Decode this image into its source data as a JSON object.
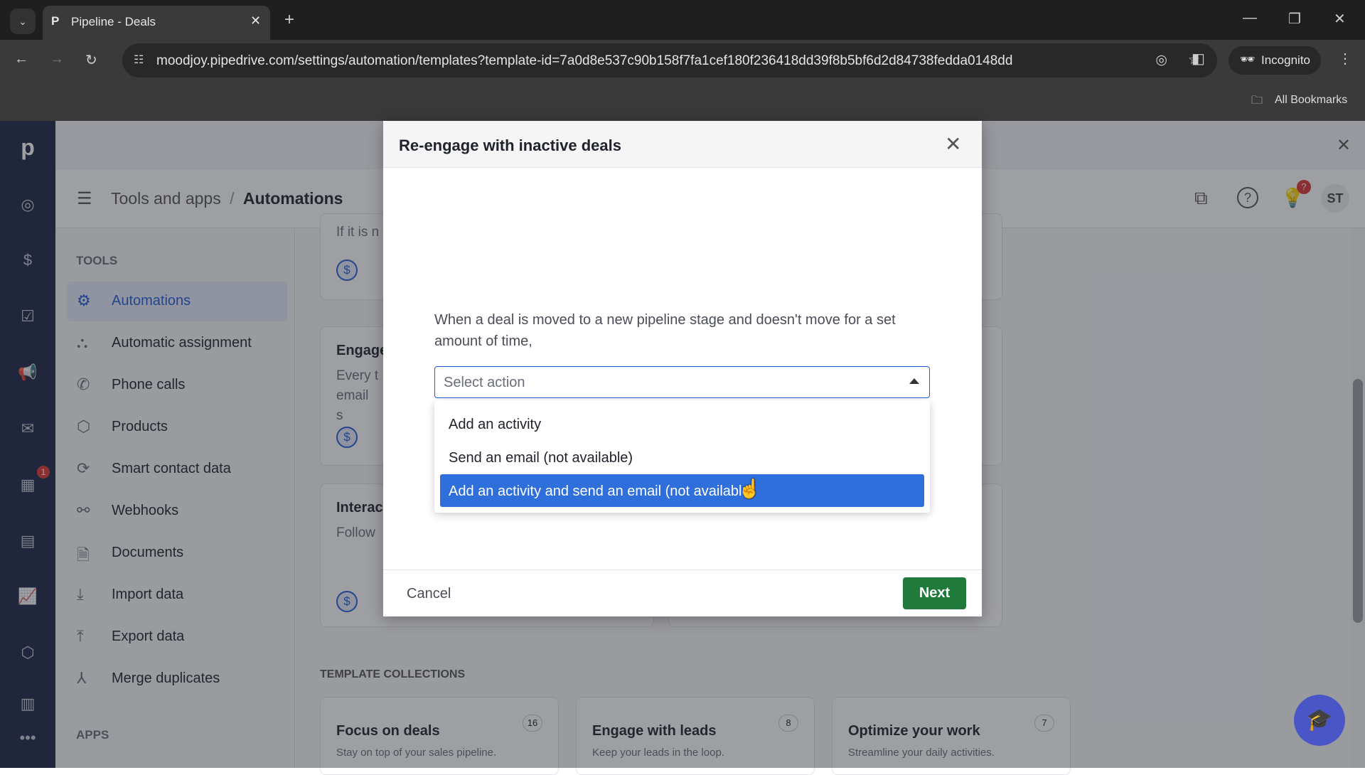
{
  "browser": {
    "tab_title": "Pipeline - Deals",
    "url": "moodjoy.pipedrive.com/settings/automation/templates?template-id=7a0d8e537c90b158f7fa1cef180f236418dd39f8b5bf6d2d84738fedda0148dd",
    "incognito_label": "Incognito",
    "bookmarks_label": "All Bookmarks"
  },
  "header": {
    "breadcrumb_parent": "Tools and apps",
    "breadcrumb_sep": "/",
    "breadcrumb_current": "Automations",
    "avatar_initials": "ST",
    "notification_badge": "?"
  },
  "sidebar": {
    "tools_heading": "TOOLS",
    "apps_heading": "APPS",
    "items": [
      {
        "label": "Automations",
        "icon": "robot-icon"
      },
      {
        "label": "Automatic assignment",
        "icon": "assignment-icon"
      },
      {
        "label": "Phone calls",
        "icon": "phone-icon"
      },
      {
        "label": "Products",
        "icon": "box-icon"
      },
      {
        "label": "Smart contact data",
        "icon": "refresh-icon"
      },
      {
        "label": "Webhooks",
        "icon": "webhook-icon"
      },
      {
        "label": "Documents",
        "icon": "document-icon"
      },
      {
        "label": "Import data",
        "icon": "import-icon"
      },
      {
        "label": "Export data",
        "icon": "export-icon"
      },
      {
        "label": "Merge duplicates",
        "icon": "merge-icon"
      }
    ]
  },
  "leftnav": {
    "activity_badge": "1"
  },
  "main": {
    "cards": [
      {
        "title": "",
        "text": "If it is n"
      },
      {
        "title": "Engage",
        "text": "Every t email s"
      },
      {
        "title": "Interac",
        "text": "Follow"
      }
    ],
    "collections_heading": "TEMPLATE COLLECTIONS",
    "collections": [
      {
        "title": "Focus on deals",
        "desc": "Stay on top of your sales pipeline.",
        "count": "16"
      },
      {
        "title": "Engage with leads",
        "desc": "Keep your leads in the loop.",
        "count": "8"
      },
      {
        "title": "Optimize your work",
        "desc": "Streamline your daily activities.",
        "count": "7"
      }
    ]
  },
  "modal": {
    "title": "Re-engage with inactive deals",
    "description": "When a deal is moved to a new pipeline stage and doesn't move for a set amount of time,",
    "select_placeholder": "Select action",
    "options": [
      "Add an activity",
      "Send an email (not available)",
      "Add an activity and send an email (not available)"
    ],
    "highlighted_option": 2,
    "cancel_label": "Cancel",
    "next_label": "Next"
  },
  "colors": {
    "primary": "#1f5bd8",
    "next_button": "#1f7a3c",
    "highlight": "#2f6fdb",
    "nav_bg": "#1b2343"
  }
}
